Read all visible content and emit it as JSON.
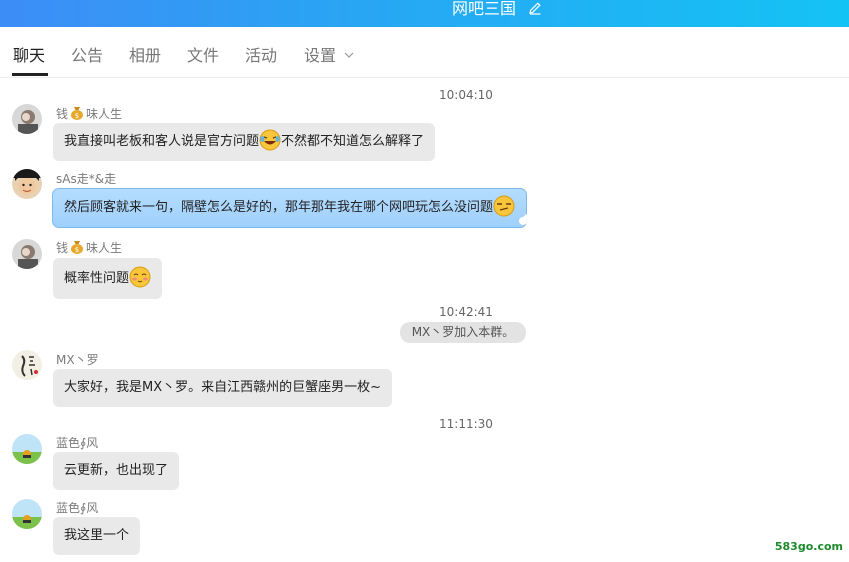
{
  "window": {
    "title": "网吧三国"
  },
  "tabs": [
    {
      "label": "聊天"
    },
    {
      "label": "公告"
    },
    {
      "label": "相册"
    },
    {
      "label": "文件"
    },
    {
      "label": "活动"
    },
    {
      "label": "设置"
    }
  ],
  "messages": [
    {
      "timestamp": "10:04:10",
      "sender_prefix": "钱",
      "sender_suffix": "味人生",
      "text": "我直接叫老板和客人说是官方问题",
      "text_after": "不然都不知道怎么解释了"
    },
    {
      "sender": "sAs走*&走",
      "text": "然后顾客就来一句，隔壁怎么是好的，那年那年我在哪个网吧玩怎么没问题"
    },
    {
      "sender_prefix": "钱",
      "sender_suffix": "味人生",
      "text": "概率性问题"
    },
    {
      "timestamp": "10:42:41",
      "system": "MX丶罗加入本群。"
    },
    {
      "sender": "MX丶罗",
      "text": "大家好，我是MX丶罗。来自江西赣州的巨蟹座男一枚~"
    },
    {
      "timestamp": "11:11:30",
      "sender": "蓝色∮风",
      "text": "云更新，也出现了"
    },
    {
      "sender": "蓝色∮风",
      "text": "我这里一个"
    }
  ],
  "watermark": "583go.com",
  "icons": [
    "edit-icon",
    "chevron-down-icon",
    "money-bag-icon",
    "laughing-emoji",
    "smug-emoji",
    "blush-emoji"
  ],
  "colors": {
    "titlebar_start": "#3d8df6",
    "titlebar_end": "#14c3f5",
    "bubble": "#e9e9e9",
    "bubble_blue": "#a9d5fd"
  }
}
